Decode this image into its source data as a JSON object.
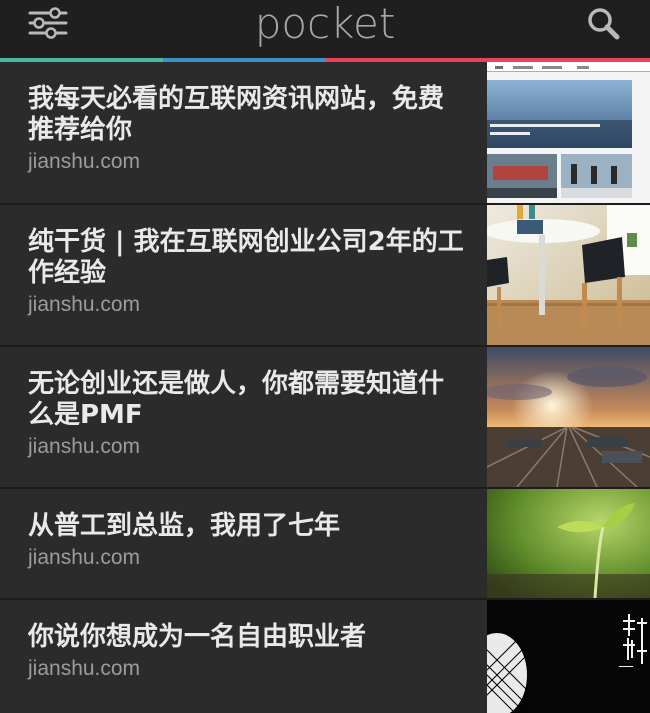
{
  "app": {
    "brand": "pocket"
  },
  "toolbar": {
    "filter_icon": "sliders-icon",
    "search_icon": "search-icon"
  },
  "stripe_colors": [
    "#45b9a3",
    "#3f8fc7",
    "#ee4056"
  ],
  "articles": [
    {
      "title": "我每天必看的互联网资讯网站，免费推荐给你",
      "domain": "jianshu.com",
      "thumbnail": "website-screenshot-thumbnail"
    },
    {
      "title": "纯干货 | 我在互联网创业公司2年的工作经验",
      "domain": "jianshu.com",
      "thumbnail": "table-and-chairs-thumbnail"
    },
    {
      "title": "无论创业还是做人，你都需要知道什么是PMF",
      "domain": "jianshu.com",
      "thumbnail": "railway-sunset-thumbnail"
    },
    {
      "title": "从普工到总监，我用了七年",
      "domain": "jianshu.com",
      "thumbnail": "sprout-thumbnail"
    },
    {
      "title": "你说你想成为一名自由职业者",
      "domain": "jianshu.com",
      "thumbnail": "book-cover-thumbnail"
    }
  ]
}
